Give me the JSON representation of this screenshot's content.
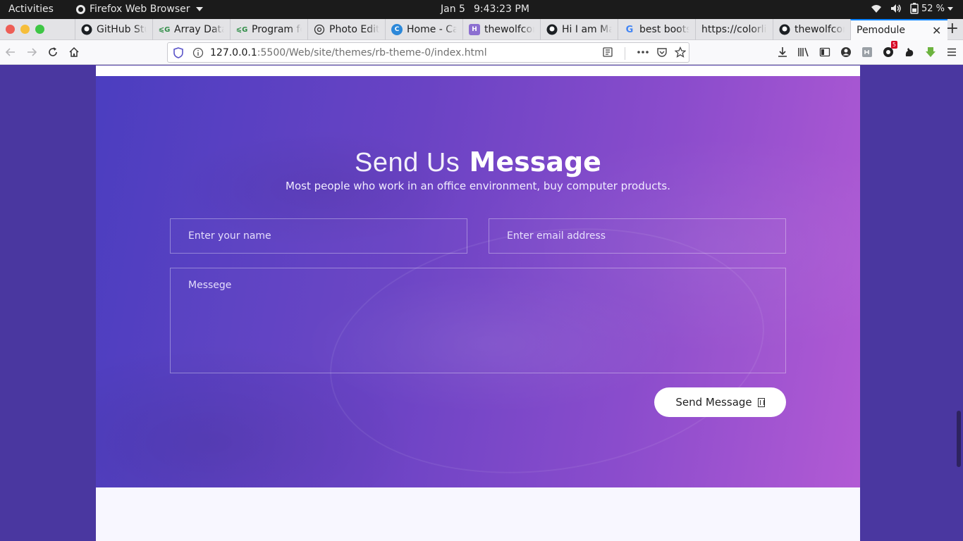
{
  "system": {
    "activities": "Activities",
    "app_name": "Firefox Web Browser",
    "date": "Jan 5",
    "time": "9:43:23 PM",
    "battery": "52 %"
  },
  "tabs": [
    {
      "label": "GitHub Stu",
      "icon": "github-icon"
    },
    {
      "label": "Array Data",
      "icon": "geeksforgeeks-icon"
    },
    {
      "label": "Program fo",
      "icon": "geeksforgeeks-icon"
    },
    {
      "label": "Photo Edit",
      "icon": "aperture-icon"
    },
    {
      "label": "Home - Ca",
      "icon": "canva-icon"
    },
    {
      "label": "thewolfcon",
      "icon": "h-icon"
    },
    {
      "label": "Hi I am Ma",
      "icon": "github-icon"
    },
    {
      "label": "best boots",
      "icon": "google-icon"
    },
    {
      "label": "https://colorlib",
      "icon": ""
    },
    {
      "label": "thewolfcon",
      "icon": "github-icon"
    }
  ],
  "active_tab": {
    "label": "Pemodule"
  },
  "url": {
    "host": "127.0.0.1",
    "rest": ":5500/Web/site/themes/rb-theme-0/index.html"
  },
  "extension_badge": "5",
  "contact": {
    "title_light": "Send Us",
    "title_bold": "Message",
    "subtitle": "Most people who work in an office environment, buy computer products.",
    "name_placeholder": "Enter your name",
    "email_placeholder": "Enter email address",
    "message_placeholder": "Messege",
    "send_label": "Send Message"
  },
  "colors": {
    "accent": "#0a84ff",
    "hero_start": "#4b3ec0",
    "hero_end": "#b25ad4",
    "page_bg": "#4a37a0"
  }
}
